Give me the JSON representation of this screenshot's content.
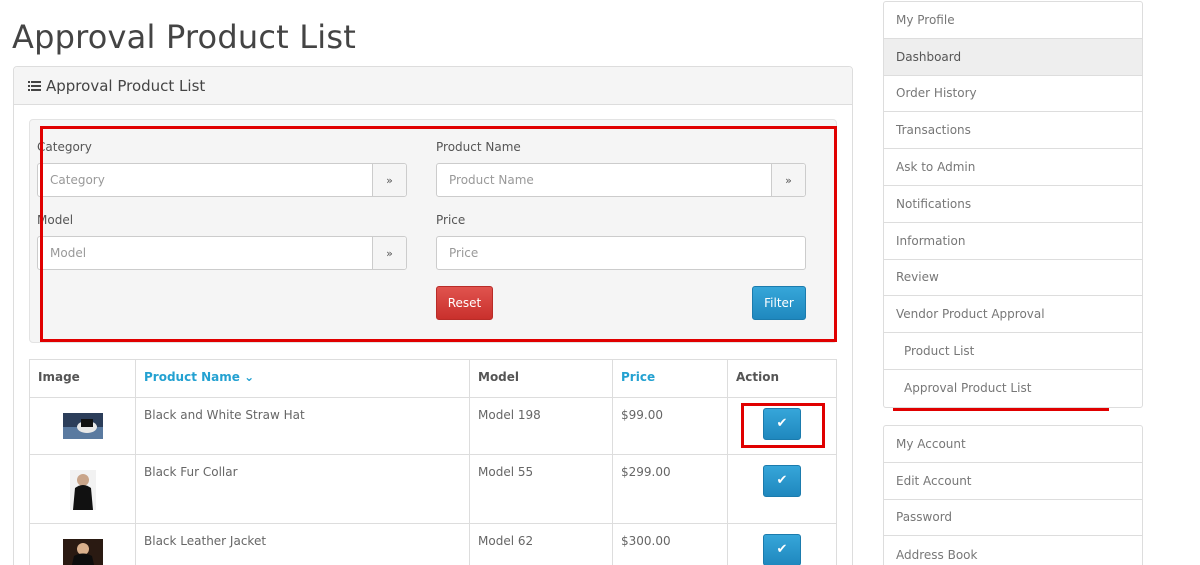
{
  "page": {
    "title": "Approval Product List"
  },
  "panel": {
    "heading": "Approval Product List",
    "icon": "list-icon"
  },
  "filter": {
    "category": {
      "label": "Category",
      "placeholder": "Category"
    },
    "product_name": {
      "label": "Product Name",
      "placeholder": "Product Name"
    },
    "model": {
      "label": "Model",
      "placeholder": "Model"
    },
    "price": {
      "label": "Price",
      "placeholder": "Price"
    },
    "reset_label": "Reset",
    "filter_label": "Filter",
    "dropdown_icon": "double-chevron-down-icon"
  },
  "table": {
    "headers": {
      "image": "Image",
      "product_name": "Product Name",
      "model": "Model",
      "price": "Price",
      "action": "Action"
    },
    "sort_indicator": "⌄",
    "rows": [
      {
        "name": "Black and White Straw Hat",
        "model": "Model 198",
        "price": "$99.00",
        "image_icon": "hat-thumbnail"
      },
      {
        "name": "Black Fur Collar",
        "model": "Model 55",
        "price": "$299.00",
        "image_icon": "fur-collar-thumbnail"
      },
      {
        "name": "Black Leather Jacket",
        "model": "Model 62",
        "price": "$300.00",
        "image_icon": "leather-jacket-thumbnail"
      }
    ],
    "approve_icon": "check-icon"
  },
  "sidebar": {
    "group1": [
      {
        "label": "My Profile"
      },
      {
        "label": "Dashboard"
      },
      {
        "label": "Order History"
      },
      {
        "label": "Transactions"
      },
      {
        "label": "Ask to Admin"
      },
      {
        "label": "Notifications"
      },
      {
        "label": "Information"
      },
      {
        "label": "Review"
      },
      {
        "label": "Vendor Product Approval"
      },
      {
        "label": "Product List"
      },
      {
        "label": "Approval Product List"
      }
    ],
    "group2": [
      {
        "label": "My Account"
      },
      {
        "label": "Edit Account"
      },
      {
        "label": "Password"
      },
      {
        "label": "Address Book"
      }
    ]
  },
  "colors": {
    "highlight": "#e00000",
    "link": "#23a1d1",
    "danger": "#d9534f",
    "primary": "#2a9fd6"
  }
}
